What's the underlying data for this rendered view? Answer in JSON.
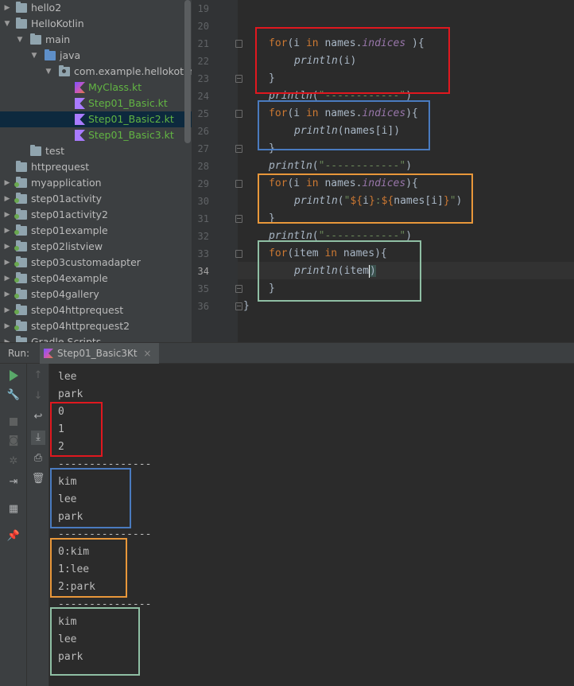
{
  "tree": {
    "rows": [
      {
        "label": "hello2"
      },
      {
        "label": "HelloKotlin"
      },
      {
        "label": "main"
      },
      {
        "label": "java"
      },
      {
        "label": "com.example.hellokotlin"
      },
      {
        "label": "MyClass.kt"
      },
      {
        "label": "Step01_Basic.kt"
      },
      {
        "label": "Step01_Basic2.kt"
      },
      {
        "label": "Step01_Basic3.kt"
      },
      {
        "label": "test"
      },
      {
        "label": "httprequest"
      },
      {
        "label": "myapplication"
      },
      {
        "label": "step01activity"
      },
      {
        "label": "step01activity2"
      },
      {
        "label": "step01example"
      },
      {
        "label": "step02listview"
      },
      {
        "label": "step03customadapter"
      },
      {
        "label": "step04example"
      },
      {
        "label": "step04gallery"
      },
      {
        "label": "step04httprequest"
      },
      {
        "label": "step04httprequest2"
      },
      {
        "label": "Gradle Scripts"
      }
    ]
  },
  "editor": {
    "line_numbers": [
      "19",
      "20",
      "21",
      "22",
      "23",
      "24",
      "25",
      "26",
      "27",
      "28",
      "29",
      "30",
      "31",
      "32",
      "33",
      "34",
      "35",
      "36"
    ],
    "code": {
      "l21_kw": "for",
      "l21_a": "(i ",
      "l21_in": "in",
      "l21_b": " names.",
      "l21_prop": "indices",
      "l21_c": " ){",
      "l22_fn": "println",
      "l22_a": "(i)",
      "l23": "}",
      "l24_fn": "println",
      "l24_a": "(",
      "l24_str": "\"------------\"",
      "l24_b": ")",
      "l25_kw": "for",
      "l25_a": "(i ",
      "l25_in": "in",
      "l25_b": " names.",
      "l25_prop": "indices",
      "l25_c": "){",
      "l26_fn": "println",
      "l26_a": "(names[i])",
      "l27": "}",
      "l28_fn": "println",
      "l28_a": "(",
      "l28_str": "\"------------\"",
      "l28_b": ")",
      "l29_kw": "for",
      "l29_a": "(i ",
      "l29_in": "in",
      "l29_b": " names.",
      "l29_prop": "indices",
      "l29_c": "){",
      "l30_fn": "println",
      "l30_a": "(",
      "l30_s1": "\"",
      "l30_t1": "${",
      "l30_v1": "i",
      "l30_t2": "}",
      "l30_s2": ":",
      "l30_t3": "${",
      "l30_v2": "names[i]",
      "l30_t4": "}",
      "l30_s3": "\"",
      "l30_b": ")",
      "l31": "}",
      "l32_fn": "println",
      "l32_a": "(",
      "l32_str": "\"------------\"",
      "l32_b": ")",
      "l33_kw": "for",
      "l33_a": "(item ",
      "l33_in": "in",
      "l33_b": " names){",
      "l34_fn": "println",
      "l34_a": "(item",
      "l34_b": ")",
      "l35": "}",
      "l36": "}"
    },
    "highlight_colors": {
      "red": "#e0181f",
      "blue": "#4a7bbf",
      "orange": "#e8973a",
      "green": "#8fbfa4"
    }
  },
  "run": {
    "label": "Run:",
    "tab_label": "Step01_Basic3Kt",
    "tab_close": "×"
  },
  "console": {
    "lines": [
      "lee",
      "park",
      "0",
      "1",
      "2",
      "---------------",
      "kim",
      "lee",
      "park",
      "---------------",
      "0:kim",
      "1:lee",
      "2:park",
      "---------------",
      "kim",
      "lee",
      "park"
    ]
  }
}
